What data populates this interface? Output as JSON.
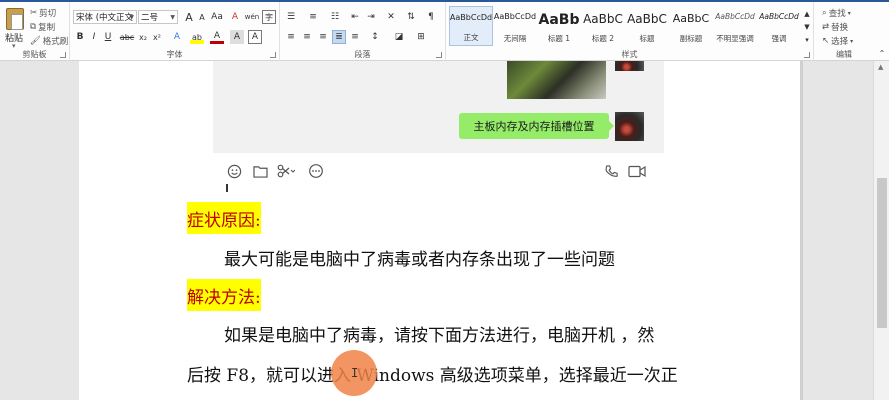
{
  "clipboard": {
    "paste": "粘贴",
    "cut": "剪切",
    "copy": "复制",
    "format_painter": "格式刷",
    "group_label": "剪贴板"
  },
  "font": {
    "family": "宋体 (中文正文",
    "size": "二号",
    "group_label": "字体",
    "bold": "B",
    "italic": "I",
    "underline": "U",
    "strike": "abc",
    "subscript": "x₂",
    "superscript": "x²",
    "grow": "A",
    "shrink": "A",
    "case": "Aa",
    "clear": "A",
    "effects": "A",
    "highlight": "ab",
    "color": "A",
    "shading": "A",
    "border": "A",
    "phonetic": "wén",
    "enclose": "字"
  },
  "paragraph": {
    "group_label": "段落"
  },
  "styles": {
    "group_label": "样式",
    "items": [
      {
        "sample": "AaBbCcDd",
        "name": "正文"
      },
      {
        "sample": "AaBbCcDd",
        "name": "无间隔"
      },
      {
        "sample": "AaBb",
        "name": "标题 1"
      },
      {
        "sample": "AaBbC",
        "name": "标题 2"
      },
      {
        "sample": "AaBbC",
        "name": "标题"
      },
      {
        "sample": "AaBbC",
        "name": "副标题"
      },
      {
        "sample": "AaBbCcDd",
        "name": "不明显强调"
      },
      {
        "sample": "AaBbCcDd",
        "name": "强调"
      }
    ]
  },
  "editing": {
    "group_label": "编辑",
    "find": "查找",
    "replace": "替换",
    "select": "选择"
  },
  "chat": {
    "bubble_text": "主板内存及内存插槽位置"
  },
  "document": {
    "heading1": "症状原因:",
    "para1": "最大可能是电脑中了病毒或者内存条出现了一些问题",
    "heading2": "解决方法:",
    "para2": "如果是电脑中了病毒，请按下面方法进行，电脑开机 ，然",
    "para3": "后按 F8，就可以进入 Windows 高级选项菜单，选择最近一次正"
  },
  "colors": {
    "accent": "#2b579a",
    "heading_text": "#c00000",
    "highlight": "#ffff00",
    "chat_bubble": "#95ec69"
  }
}
